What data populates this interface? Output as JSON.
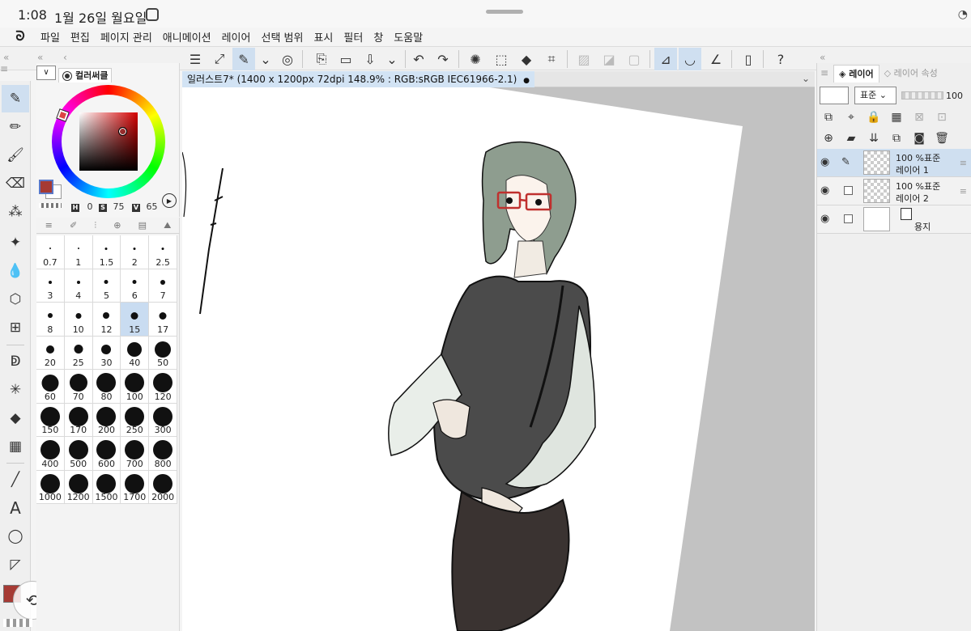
{
  "status_bar": {
    "time": "1:08",
    "date": "1월 26일 월요일"
  },
  "menu": [
    "파일",
    "편집",
    "페이지 관리",
    "애니메이션",
    "레이어",
    "선택 범위",
    "표시",
    "필터",
    "창",
    "도움말"
  ],
  "document": {
    "tab_label": "일러스트7* (1400 x 1200px 72dpi 148.9% : RGB:sRGB IEC61966-2.1)",
    "modified_dot": "●"
  },
  "color_panel": {
    "tab_label": "컬러써클",
    "dropdown": "∨",
    "h_label": "H",
    "h_value": "0",
    "s_label": "S",
    "s_value": "75",
    "v_label": "V",
    "v_value": "65",
    "main_color": "#a63a34",
    "sub_color": "#ffffff"
  },
  "brush_sizes": [
    "0.7",
    "1",
    "1.5",
    "2",
    "2.5",
    "3",
    "4",
    "5",
    "6",
    "7",
    "8",
    "10",
    "12",
    "15",
    "17",
    "20",
    "25",
    "30",
    "40",
    "50",
    "60",
    "70",
    "80",
    "100",
    "120",
    "150",
    "170",
    "200",
    "250",
    "300",
    "400",
    "500",
    "600",
    "700",
    "800",
    "1000",
    "1200",
    "1500",
    "1700",
    "2000"
  ],
  "selected_brush_size": "15",
  "layer_panel": {
    "tab_layer": "레이어",
    "tab_property": "레이어 속성",
    "blend_mode": "표준",
    "opacity": "100",
    "layers": [
      {
        "line1": "100 %표준",
        "line2": "레이어 1",
        "selected": true
      },
      {
        "line1": "100 %표준",
        "line2": "레이어 2",
        "selected": false
      },
      {
        "line1": "",
        "line2": "용지",
        "selected": false
      }
    ]
  },
  "icons": {
    "logo": "clip-studio-logo",
    "eye": "eye-icon",
    "pen": "pen-icon"
  }
}
